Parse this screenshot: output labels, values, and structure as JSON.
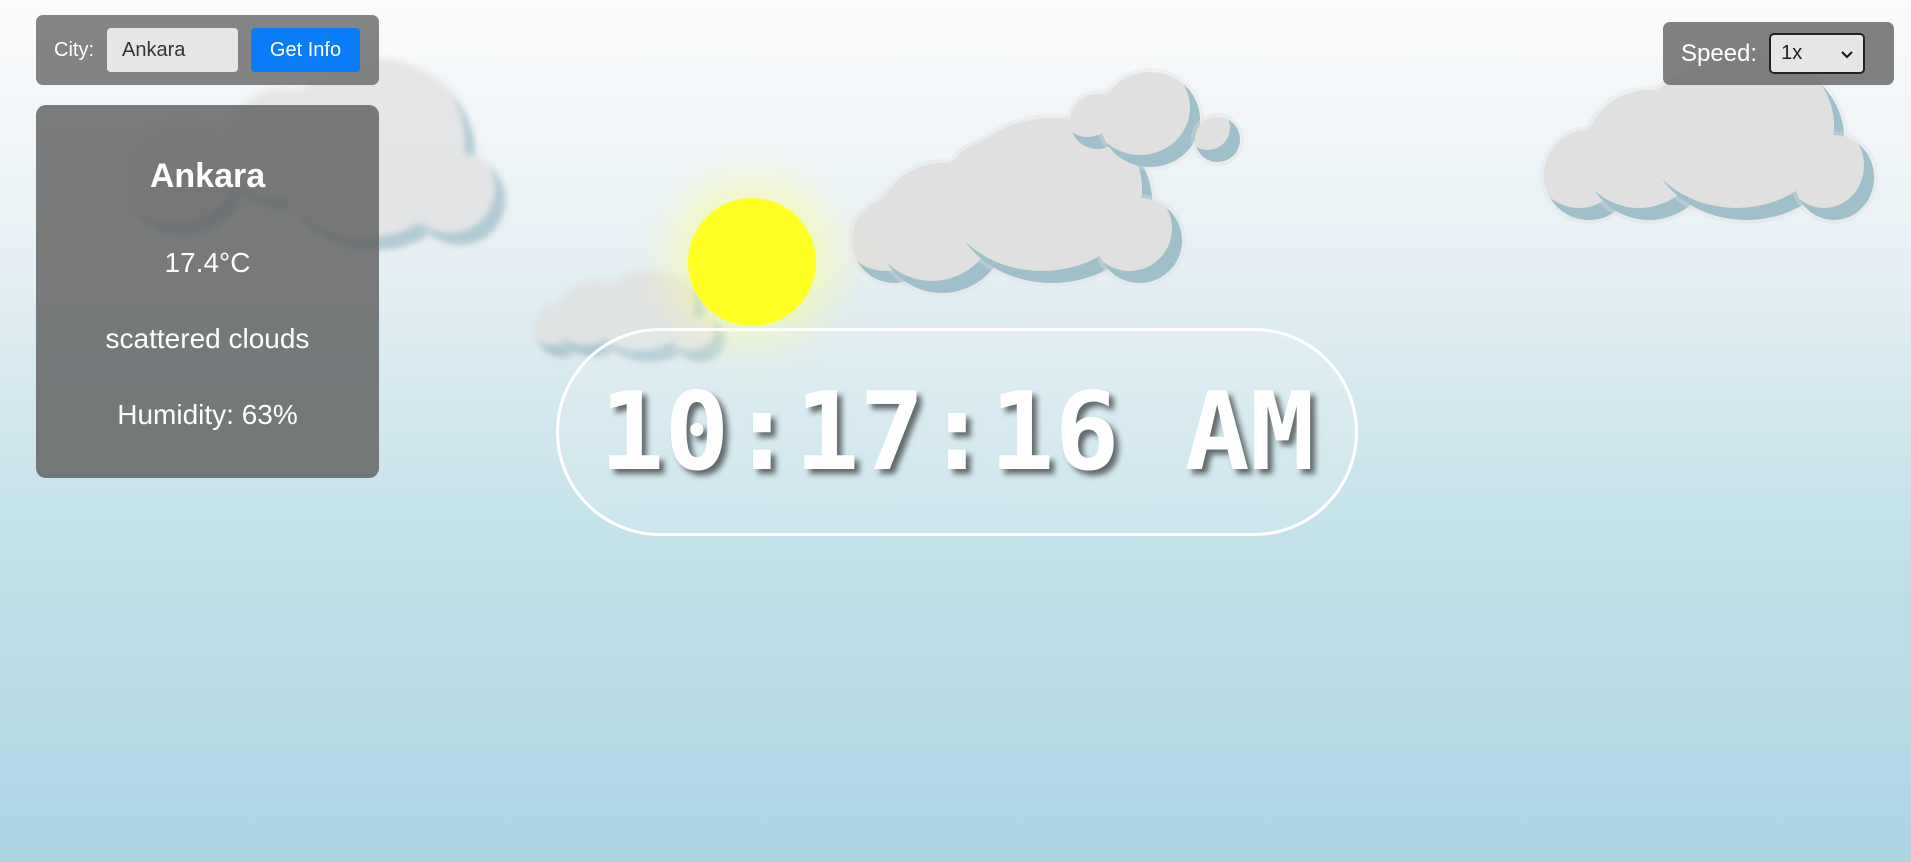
{
  "city_bar": {
    "label": "City:",
    "input_value": "Ankara",
    "button_label": "Get Info"
  },
  "weather": {
    "city": "Ankara",
    "temperature": "17.4°C",
    "description": "scattered clouds",
    "humidity": "Humidity: 63%"
  },
  "clock": {
    "time": "10:17:16 AM"
  },
  "speed": {
    "label": "Speed:",
    "selected": "1x"
  },
  "icons": {
    "sun": "sun-icon",
    "cloud": "cloud-icon",
    "select_arrow": "chevron-down-icon"
  },
  "colors": {
    "sun": "#ffff22",
    "button": "#0a7cf8",
    "panel": "#6e6e6e"
  }
}
